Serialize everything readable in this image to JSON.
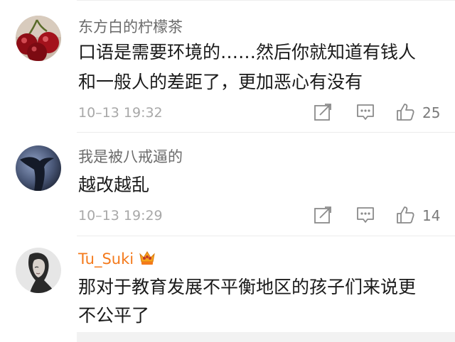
{
  "comments": [
    {
      "username": "东方白的柠檬茶",
      "lines": [
        "口语是需要环境的……然后你就知道有钱人",
        "和一般人的差距了，更加恶心有没有"
      ],
      "timestamp": "10–13 19:32",
      "likes": "25",
      "avatar": "cherries-avatar"
    },
    {
      "username": "我是被八戒逼的",
      "lines": [
        "越改越乱"
      ],
      "timestamp": "10–13 19:29",
      "likes": "14",
      "avatar": "silhouette-avatar"
    },
    {
      "username": "Tu_Suki",
      "vip": true,
      "lines": [
        "那对于教育发展不平衡地区的孩子们来说更",
        "不公平了"
      ],
      "avatar": "portrait-avatar"
    }
  ],
  "icons": {
    "repost": "share-icon",
    "reply": "comment-icon",
    "like": "thumbs-up-icon",
    "vip": "crown-badge-icon"
  },
  "colors": {
    "username": "#6b6b6b",
    "vip_username": "#f47a1c",
    "text": "#1a1a1a",
    "meta": "#a8a8a8"
  }
}
